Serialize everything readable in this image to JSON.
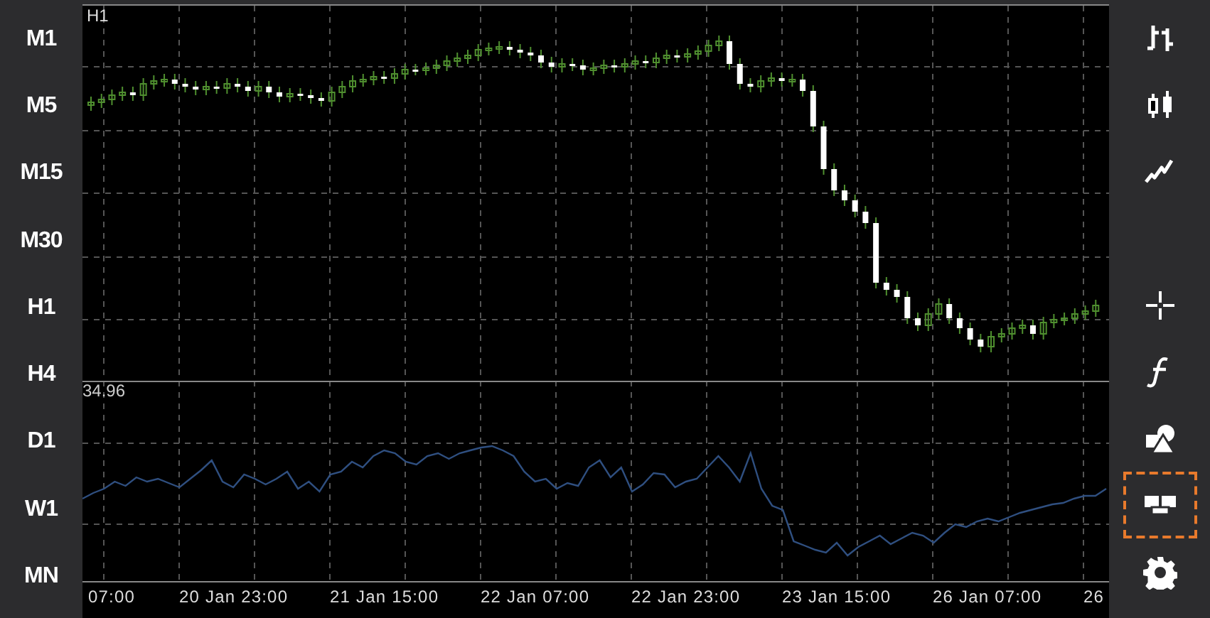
{
  "timeframes": [
    {
      "label": "M1"
    },
    {
      "label": "M5"
    },
    {
      "label": "M15"
    },
    {
      "label": "M30"
    },
    {
      "label": "H1"
    },
    {
      "label": "H4"
    },
    {
      "label": "D1"
    },
    {
      "label": "W1"
    },
    {
      "label": "MN"
    }
  ],
  "chart": {
    "period": "H1",
    "indicator_value": "34.96",
    "time_labels": [
      "07:00",
      "20 Jan 23:00",
      "21 Jan 15:00",
      "22 Jan 07:00",
      "22 Jan 23:00",
      "23 Jan 15:00",
      "26 Jan 07:00",
      "26"
    ]
  },
  "tools": [
    {
      "kind": "bars",
      "selected": false
    },
    {
      "kind": "candles",
      "selected": false
    },
    {
      "kind": "line",
      "selected": false
    },
    {
      "kind": "blank",
      "selected": false
    },
    {
      "kind": "crosshair",
      "selected": false
    },
    {
      "kind": "indicator",
      "selected": false
    },
    {
      "kind": "objects",
      "selected": false
    },
    {
      "kind": "windows",
      "selected": true
    },
    {
      "kind": "settings",
      "selected": false
    }
  ]
}
